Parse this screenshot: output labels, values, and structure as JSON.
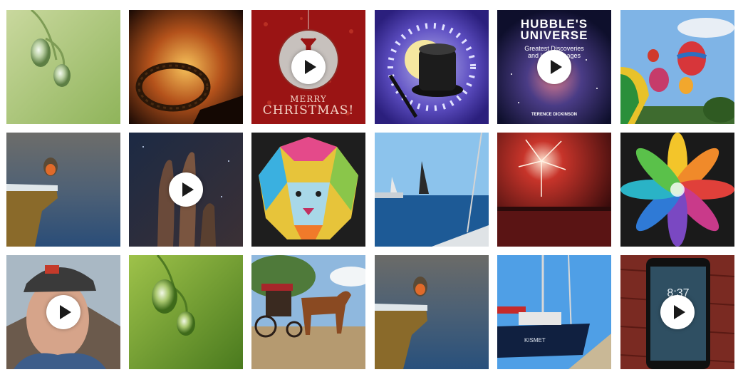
{
  "gallery": {
    "tiles": [
      {
        "name": "water-drops-photo",
        "video": false
      },
      {
        "name": "crown-of-thorns-photo",
        "video": false
      },
      {
        "name": "merry-christmas-card",
        "video": true,
        "line1": "MERRY",
        "line2": "CHRISTMAS!"
      },
      {
        "name": "magic-top-hat-illustration",
        "video": false
      },
      {
        "name": "hubbles-universe-cover",
        "video": true,
        "title1": "HUBBLE'S",
        "title2": "UNIVERSE",
        "sub1": "Greatest Discoveries",
        "sub2": "and Latest Images",
        "author": "TERENCE DICKINSON"
      },
      {
        "name": "hot-air-balloons-photo",
        "video": false
      },
      {
        "name": "robin-on-rock-photo",
        "video": false
      },
      {
        "name": "pillars-of-creation-photo",
        "video": true
      },
      {
        "name": "polygon-lion-art",
        "video": false
      },
      {
        "name": "sailboats-photo",
        "video": false
      },
      {
        "name": "fireworks-photo",
        "video": false
      },
      {
        "name": "rainbow-flower-logo",
        "video": false
      },
      {
        "name": "man-with-cap-selfie",
        "video": true
      },
      {
        "name": "water-drops-photo-2",
        "video": false
      },
      {
        "name": "horse-carriage-photo",
        "video": false
      },
      {
        "name": "robin-on-rock-photo-2",
        "video": false
      },
      {
        "name": "sailboat-kismet-photo",
        "video": false,
        "boat_name": "KISMET"
      },
      {
        "name": "smartphone-photo",
        "video": true,
        "clock": "8:37"
      }
    ]
  },
  "icons": {
    "play": "play-icon"
  },
  "colors": {
    "background": "#ffffff",
    "play_button": "#ffffff",
    "play_triangle": "#1a1a1a"
  }
}
